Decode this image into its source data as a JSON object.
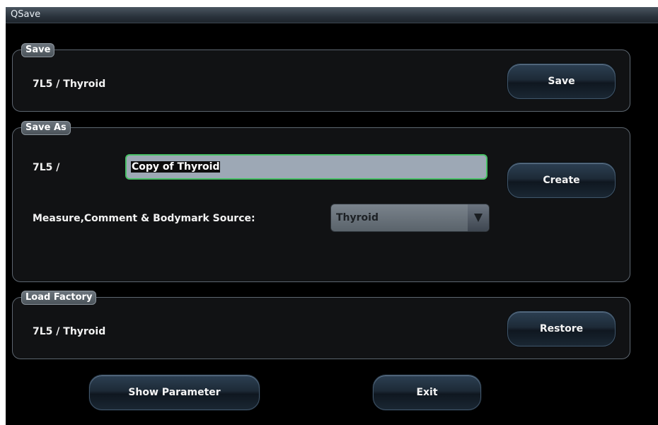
{
  "window": {
    "title": "QSave"
  },
  "save": {
    "legend": "Save",
    "label": "7L5  /  Thyroid",
    "button": "Save"
  },
  "save_as": {
    "legend": "Save As",
    "prefix": "7L5  /",
    "name_value": "Copy of Thyroid",
    "button": "Create",
    "source_label": "Measure,Comment & Bodymark Source:",
    "source_selected": "Thyroid"
  },
  "load_factory": {
    "legend": "Load Factory",
    "label": "7L5  /  Thyroid",
    "button": "Restore"
  },
  "footer": {
    "show_parameter": "Show Parameter",
    "exit": "Exit"
  }
}
